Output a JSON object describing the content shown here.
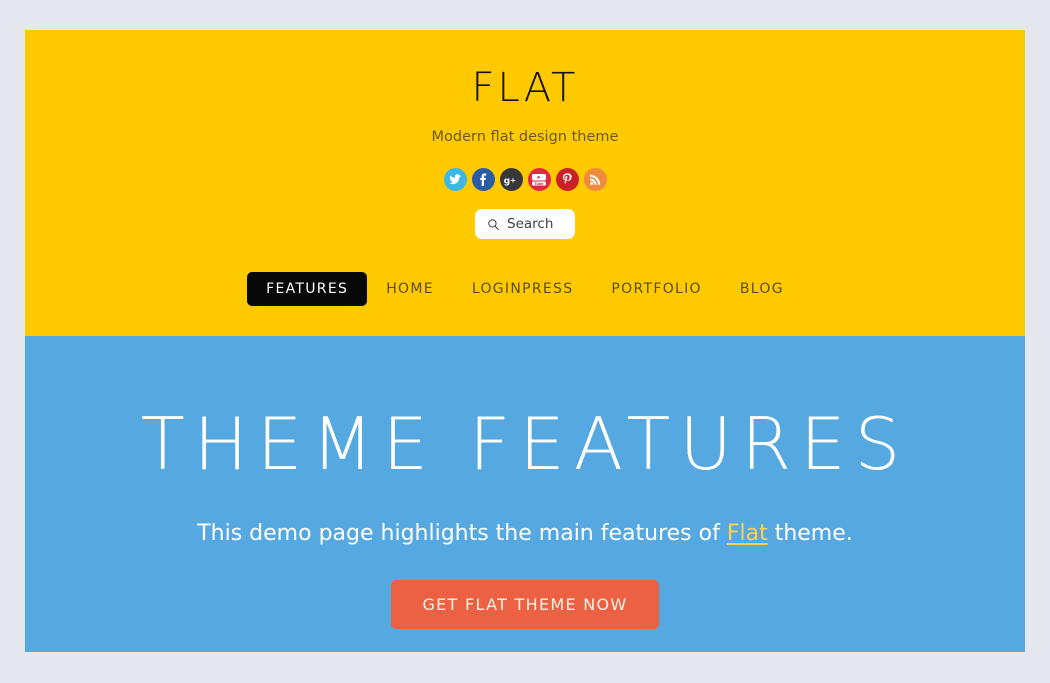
{
  "site": {
    "title": "FLAT",
    "tagline": "Modern flat design theme"
  },
  "colors": {
    "page_background": "#e4e7ee",
    "header_background": "#ffc900",
    "hero_background": "#55a9e0",
    "cta_background": "#ec6044",
    "cta_text": "#fdf4e3",
    "nav_active_background": "#080808",
    "nav_text": "#5c4f17",
    "hero_link": "#ffd24a"
  },
  "social": {
    "items": [
      {
        "name": "twitter-icon",
        "label": "Twitter",
        "color": "#3cb7e8"
      },
      {
        "name": "facebook-icon",
        "label": "Facebook",
        "color": "#2a5ba4"
      },
      {
        "name": "google-plus-icon",
        "label": "Google Plus",
        "color": "#383838"
      },
      {
        "name": "youtube-icon",
        "label": "YouTube",
        "color": "#e32644"
      },
      {
        "name": "pinterest-icon",
        "label": "Pinterest",
        "color": "#cb2027"
      },
      {
        "name": "rss-icon",
        "label": "RSS",
        "color": "#f08a3c"
      }
    ]
  },
  "search": {
    "placeholder": "Search",
    "value": "",
    "icon": "search-icon"
  },
  "nav": {
    "items": [
      {
        "label": "FEATURES",
        "active": true
      },
      {
        "label": "HOME",
        "active": false
      },
      {
        "label": "LOGINPRESS",
        "active": false
      },
      {
        "label": "PORTFOLIO",
        "active": false
      },
      {
        "label": "BLOG",
        "active": false
      }
    ]
  },
  "hero": {
    "title": "THEME FEATURES",
    "subtitle_before": "This demo page highlights the main features of ",
    "subtitle_link": "Flat",
    "subtitle_after": " theme.",
    "cta_label": "GET FLAT THEME NOW"
  }
}
